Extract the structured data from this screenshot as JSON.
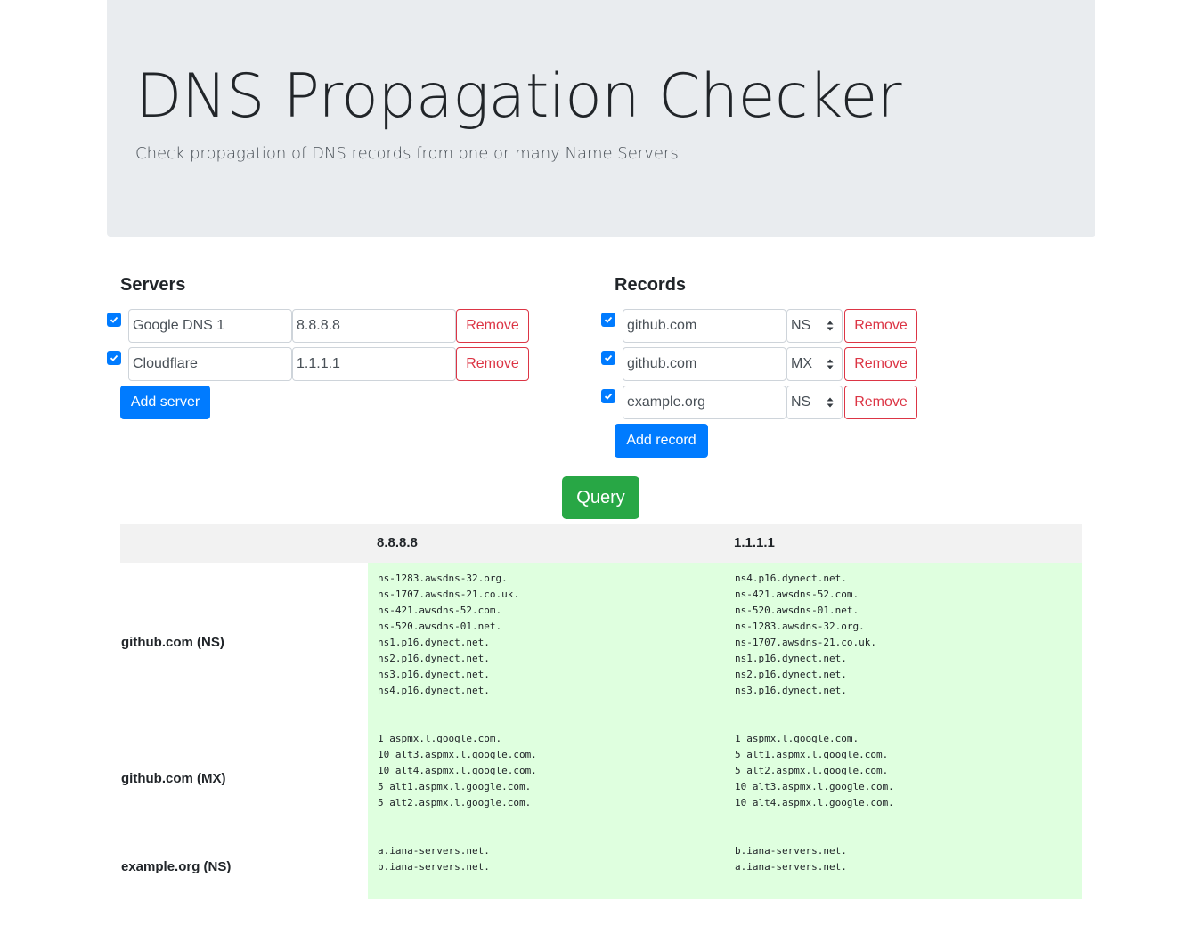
{
  "header": {
    "title": "DNS Propagation Checker",
    "subtitle": "Check propagation of DNS records from one or many Name Servers"
  },
  "servers": {
    "heading": "Servers",
    "items": [
      {
        "checked": true,
        "name": "Google DNS 1",
        "ip": "8.8.8.8",
        "remove_label": "Remove"
      },
      {
        "checked": true,
        "name": "Cloudflare",
        "ip": "1.1.1.1",
        "remove_label": "Remove"
      }
    ],
    "add_label": "Add server"
  },
  "records": {
    "heading": "Records",
    "items": [
      {
        "checked": true,
        "domain": "github.com",
        "type": "NS",
        "remove_label": "Remove"
      },
      {
        "checked": true,
        "domain": "github.com",
        "type": "MX",
        "remove_label": "Remove"
      },
      {
        "checked": true,
        "domain": "example.org",
        "type": "NS",
        "remove_label": "Remove"
      }
    ],
    "add_label": "Add record"
  },
  "query_label": "Query",
  "results": {
    "columns": [
      "8.8.8.8",
      "1.1.1.1"
    ],
    "rows": [
      {
        "label": "github.com (NS)",
        "cells": [
          [
            "ns-1283.awsdns-32.org.",
            "ns-1707.awsdns-21.co.uk.",
            "ns-421.awsdns-52.com.",
            "ns-520.awsdns-01.net.",
            "ns1.p16.dynect.net.",
            "ns2.p16.dynect.net.",
            "ns3.p16.dynect.net.",
            "ns4.p16.dynect.net."
          ],
          [
            "ns4.p16.dynect.net.",
            "ns-421.awsdns-52.com.",
            "ns-520.awsdns-01.net.",
            "ns-1283.awsdns-32.org.",
            "ns-1707.awsdns-21.co.uk.",
            "ns1.p16.dynect.net.",
            "ns2.p16.dynect.net.",
            "ns3.p16.dynect.net."
          ]
        ]
      },
      {
        "label": "github.com (MX)",
        "cells": [
          [
            "1 aspmx.l.google.com.",
            "10 alt3.aspmx.l.google.com.",
            "10 alt4.aspmx.l.google.com.",
            "5 alt1.aspmx.l.google.com.",
            "5 alt2.aspmx.l.google.com."
          ],
          [
            "1 aspmx.l.google.com.",
            "5 alt1.aspmx.l.google.com.",
            "5 alt2.aspmx.l.google.com.",
            "10 alt3.aspmx.l.google.com.",
            "10 alt4.aspmx.l.google.com."
          ]
        ]
      },
      {
        "label": "example.org (NS)",
        "cells": [
          [
            "a.iana-servers.net.",
            "b.iana-servers.net."
          ],
          [
            "b.iana-servers.net.",
            "a.iana-servers.net."
          ]
        ]
      }
    ]
  },
  "colors": {
    "primary": "#007bff",
    "danger": "#dc3545",
    "success": "#28a745",
    "result_bg": "#dfffdf",
    "jumbotron_bg": "#e9ecef"
  }
}
